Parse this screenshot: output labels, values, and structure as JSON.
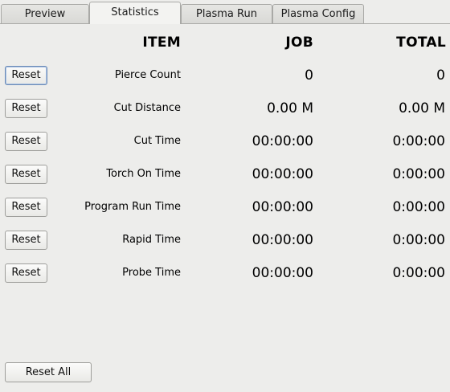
{
  "tabs": [
    {
      "label": "Preview"
    },
    {
      "label": "Statistics"
    },
    {
      "label": "Plasma Run"
    },
    {
      "label": "Plasma Config"
    }
  ],
  "active_tab": "Statistics",
  "headers": {
    "item": "ITEM",
    "job": "JOB",
    "total": "TOTAL"
  },
  "reset_label": "Reset",
  "reset_all_label": "Reset All",
  "rows": [
    {
      "label": "Pierce Count",
      "job": "0",
      "total": "0"
    },
    {
      "label": "Cut Distance",
      "job": "0.00 M",
      "total": "0.00 M"
    },
    {
      "label": "Cut Time",
      "job": "00:00:00",
      "total": "0:00:00"
    },
    {
      "label": "Torch On Time",
      "job": "00:00:00",
      "total": "0:00:00"
    },
    {
      "label": "Program Run Time",
      "job": "00:00:00",
      "total": "0:00:00"
    },
    {
      "label": "Rapid Time",
      "job": "00:00:00",
      "total": "0:00:00"
    },
    {
      "label": "Probe Time",
      "job": "00:00:00",
      "total": "0:00:00"
    }
  ]
}
